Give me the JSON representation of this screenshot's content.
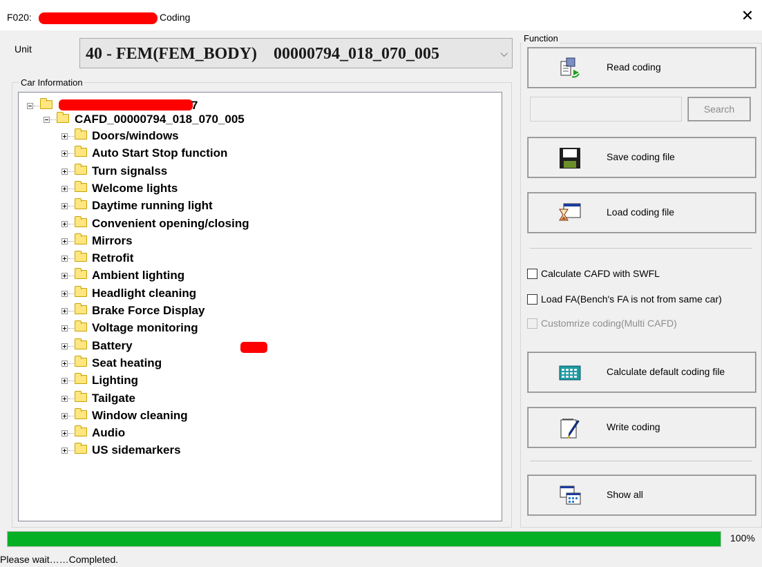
{
  "window": {
    "title_prefix": "F020:",
    "title_suffix": "Coding",
    "close_glyph": "✕"
  },
  "unit": {
    "label": "Unit",
    "selected_value": "40 - FEM(FEM_BODY)    00000794_018_070_005",
    "chevron": "⌵"
  },
  "car_info": {
    "group_title": "Car Information",
    "root_suffix": "7",
    "cafd": "CAFD_00000794_018_070_005",
    "items": [
      "Doors/windows",
      "Auto Start Stop function",
      "Turn signalss",
      "Welcome lights",
      "Daytime running light",
      "Convenient opening/closing",
      "Mirrors",
      "Retrofit",
      "Ambient lighting",
      "Headlight cleaning",
      "Brake Force Display",
      "Voltage monitoring",
      "Battery",
      "Seat heating",
      "Lighting",
      "Tailgate",
      "Window cleaning",
      "Audio",
      "US sidemarkers"
    ]
  },
  "function": {
    "group_title": "Function",
    "read_coding": "Read coding",
    "search_value": "",
    "search_button": "Search",
    "save_coding_file": "Save coding file",
    "load_coding_file": "Load coding file",
    "calc_cafd_swfl": "Calculate CAFD with SWFL",
    "load_fa": "Load FA(Bench's FA is not from same car)",
    "customize_coding": "Customrize coding(Multi CAFD)",
    "calc_default": "Calculate default coding file",
    "write_coding": "Write coding",
    "show_all": "Show all"
  },
  "progress": {
    "percent": 100,
    "label": "100%"
  },
  "status": {
    "text": "Please wait……Completed."
  },
  "colors": {
    "progress_fill": "#06b025",
    "redaction": "#ff0000"
  }
}
